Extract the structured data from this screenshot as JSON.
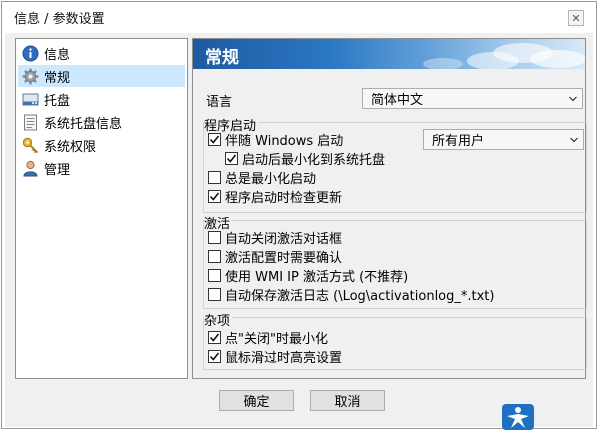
{
  "window": {
    "title": "信息 / 参数设置",
    "close_glyph": "✕"
  },
  "nav": {
    "items": [
      {
        "label": "信息",
        "icon": "info-icon",
        "selected": false
      },
      {
        "label": "常规",
        "icon": "gear-icon",
        "selected": true
      },
      {
        "label": "托盘",
        "icon": "tray-icon",
        "selected": false
      },
      {
        "label": "系统托盘信息",
        "icon": "document-icon",
        "selected": false
      },
      {
        "label": "系统权限",
        "icon": "key-icon",
        "selected": false
      },
      {
        "label": "管理",
        "icon": "user-icon",
        "selected": false
      }
    ]
  },
  "content": {
    "header": "常规",
    "language": {
      "label": "语言",
      "value": "简体中文"
    },
    "startup": {
      "title": "程序启动",
      "run_with_windows": {
        "label": "伴随 Windows 启动",
        "checked": true
      },
      "users_select": {
        "value": "所有用户"
      },
      "minimize_to_tray": {
        "label": "启动后最小化到系统托盘",
        "checked": true
      },
      "always_minimized": {
        "label": "总是最小化启动",
        "checked": false
      },
      "check_updates": {
        "label": "程序启动时检查更新",
        "checked": true
      }
    },
    "activation": {
      "title": "激活",
      "options": [
        {
          "label": "自动关闭激活对话框",
          "checked": false
        },
        {
          "label": "激活配置时需要确认",
          "checked": false
        },
        {
          "label": "使用 WMI IP 激活方式 (不推荐)",
          "checked": false
        },
        {
          "label": "自动保存激活日志 (\\Log\\activationlog_*.txt)",
          "checked": false
        }
      ]
    },
    "misc": {
      "title": "杂项",
      "options": [
        {
          "label": "点\"关闭\"时最小化",
          "checked": true
        },
        {
          "label": "鼠标滑过时高亮设置",
          "checked": true
        }
      ]
    }
  },
  "buttons": {
    "ok": "确定",
    "cancel": "取消"
  },
  "colors": {
    "accent_blue": "#2b78c2",
    "selection": "#cce8ff",
    "face": "#f0f0f0"
  }
}
